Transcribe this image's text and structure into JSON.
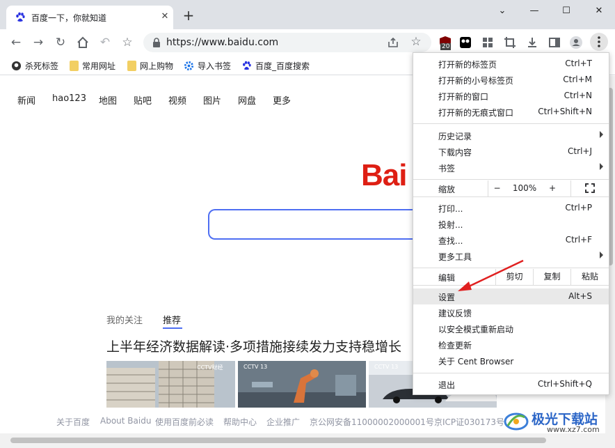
{
  "tab": {
    "title": "百度一下，你就知道",
    "close_label": "✕"
  },
  "new_tab_label": "+",
  "window_controls": {
    "chevron": "⌄",
    "minimize": "—",
    "maximize": "☐",
    "close": "✕"
  },
  "toolbar": {
    "url": "https://www.baidu.com",
    "extension_badge": "20"
  },
  "bookmarks": [
    {
      "label": "杀死标签",
      "icon": "github-icon"
    },
    {
      "label": "常用网址",
      "icon": "folder-icon"
    },
    {
      "label": "网上购物",
      "icon": "folder-icon"
    },
    {
      "label": "导入书签",
      "icon": "gear-icon"
    },
    {
      "label": "百度_百度搜索",
      "icon": "baidu-paw-icon"
    }
  ],
  "page": {
    "nav_links": [
      "新闻",
      "hao123",
      "地图",
      "贴吧",
      "视频",
      "图片",
      "网盘",
      "更多"
    ],
    "logo_text": "Bai",
    "feed_tabs": [
      "我的关注",
      "推荐"
    ],
    "feed_title": "上半年经济数据解读·多项措施接续发力支持稳增长",
    "thumb_captions": [
      "CCTV财经",
      "CCTV 13",
      "CCTV 13"
    ],
    "footer_links": [
      "关于百度",
      "About Baidu",
      "使用百度前必读",
      "帮助中心",
      "企业推广",
      "京公网安备11000002000001号",
      "京ICP证030173号"
    ]
  },
  "menu": {
    "group1": [
      {
        "label": "打开新的标签页",
        "shortcut": "Ctrl+T"
      },
      {
        "label": "打开新的小号标签页",
        "shortcut": "Ctrl+M"
      },
      {
        "label": "打开新的窗口",
        "shortcut": "Ctrl+N"
      },
      {
        "label": "打开新的无痕式窗口",
        "shortcut": "Ctrl+Shift+N"
      }
    ],
    "group2": [
      {
        "label": "历史记录",
        "shortcut": ""
      },
      {
        "label": "下载内容",
        "shortcut": "Ctrl+J"
      },
      {
        "label": "书签",
        "shortcut": ""
      }
    ],
    "zoom": {
      "label": "缩放",
      "minus": "−",
      "value": "100%",
      "plus": "+",
      "fullscreen": "⛶"
    },
    "group3": [
      {
        "label": "打印...",
        "shortcut": "Ctrl+P"
      },
      {
        "label": "投射...",
        "shortcut": ""
      },
      {
        "label": "查找...",
        "shortcut": "Ctrl+F"
      },
      {
        "label": "更多工具",
        "shortcut": ""
      }
    ],
    "edit": {
      "label": "编辑",
      "cut": "剪切",
      "copy": "复制",
      "paste": "粘贴"
    },
    "group4": [
      {
        "label": "设置",
        "shortcut": "Alt+S"
      },
      {
        "label": "建议反馈",
        "shortcut": ""
      },
      {
        "label": "以安全模式重新启动",
        "shortcut": ""
      },
      {
        "label": "检查更新",
        "shortcut": ""
      },
      {
        "label": "关于 Cent Browser",
        "shortcut": ""
      }
    ],
    "exit": {
      "label": "退出",
      "shortcut": "Ctrl+Shift+Q"
    }
  },
  "watermark": {
    "name": "极光下载站",
    "url": "www.xz7.com"
  },
  "colors": {
    "accent_red": "#de1f14",
    "search_border": "#4e6ef2",
    "annotation_arrow": "#e02020"
  }
}
